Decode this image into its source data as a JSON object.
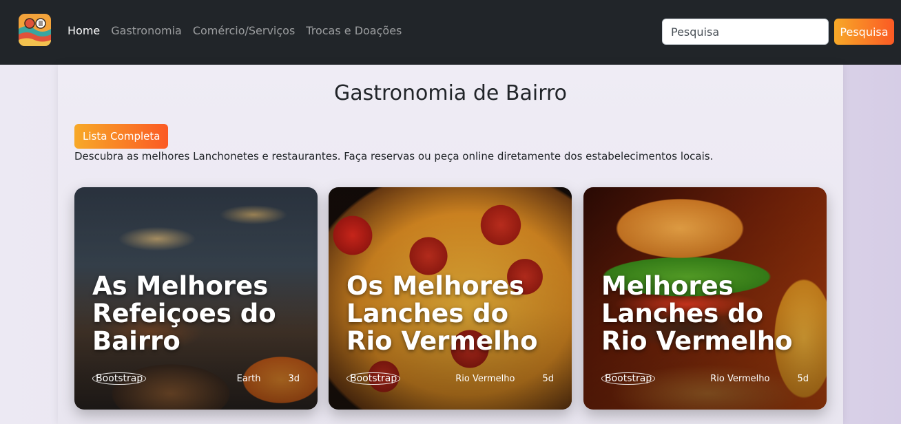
{
  "nav": {
    "links": [
      "Home",
      "Gastronomia",
      "Comércio/Serviços",
      "Trocas e Doações"
    ],
    "search_placeholder": "Pesquisa",
    "search_button": "Pesquisa"
  },
  "main": {
    "title": "Gastronomia de Bairro",
    "list_button": "Lista Completa",
    "description": "Descubra as melhores Lanchonetes e restaurantes. Faça reservas ou peça online diretamente dos estabelecimentos locais."
  },
  "cards": [
    {
      "title": "As Melhores Refeiçoes do Bairro",
      "tag": "Bootstrap",
      "location": "Earth",
      "time": "3d"
    },
    {
      "title": "Os Melhores Lanches do Rio Vermelho",
      "tag": "Bootstrap",
      "location": "Rio Vermelho",
      "time": "5d"
    },
    {
      "title": "Melhores Lanches do Rio Vermelho",
      "tag": "Bootstrap",
      "location": "Rio Vermelho",
      "time": "5d"
    }
  ],
  "colors": {
    "navbar": "#212529",
    "accent_start": "#f7a928",
    "accent_end": "#fb5a24"
  }
}
